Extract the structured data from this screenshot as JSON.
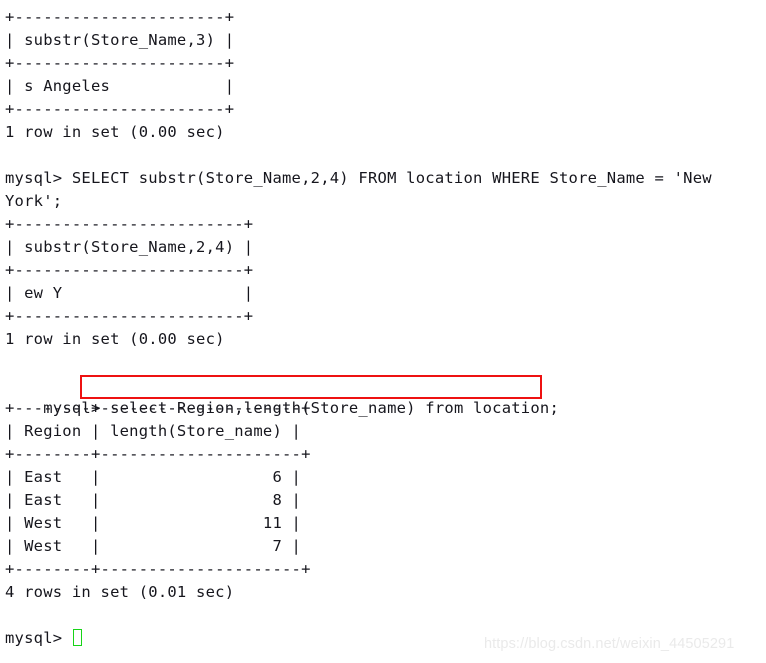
{
  "terminal": {
    "prompt": "mysql> ",
    "cursor_color": "#17d417",
    "text_color": "#16161d",
    "background_color": "#ffffff",
    "annotation_color": "#ee1111",
    "lines": [
      {
        "id": "l01",
        "text": "+----------------------+"
      },
      {
        "id": "l02",
        "text": "| substr(Store_Name,3) |"
      },
      {
        "id": "l03",
        "text": "+----------------------+"
      },
      {
        "id": "l04",
        "text": "| s Angeles            |"
      },
      {
        "id": "l05",
        "text": "+----------------------+"
      },
      {
        "id": "l06",
        "text": "1 row in set (0.00 sec)"
      },
      {
        "id": "l07",
        "text": ""
      },
      {
        "id": "l08",
        "text": "mysql> SELECT substr(Store_Name,2,4) FROM location WHERE Store_Name = 'New"
      },
      {
        "id": "l09",
        "text": "York';"
      },
      {
        "id": "l10",
        "text": "+------------------------+"
      },
      {
        "id": "l11",
        "text": "| substr(Store_Name,2,4) |"
      },
      {
        "id": "l12",
        "text": "+------------------------+"
      },
      {
        "id": "l13",
        "text": "| ew Y                   |"
      },
      {
        "id": "l14",
        "text": "+------------------------+"
      },
      {
        "id": "l15",
        "text": "1 row in set (0.00 sec)"
      },
      {
        "id": "l16",
        "text": ""
      },
      {
        "id": "l17",
        "text": "mysql> select Region,length(Store_name) from location;"
      },
      {
        "id": "l18",
        "text": "+--------+---------------------+"
      },
      {
        "id": "l19",
        "text": "| Region | length(Store_name) |"
      },
      {
        "id": "l20",
        "text": "+--------+---------------------+"
      },
      {
        "id": "l21",
        "text": "| East   |                  6 |"
      },
      {
        "id": "l22",
        "text": "| East   |                  8 |"
      },
      {
        "id": "l23",
        "text": "| West   |                 11 |"
      },
      {
        "id": "l24",
        "text": "| West   |                  7 |"
      },
      {
        "id": "l25",
        "text": "+--------+---------------------+"
      },
      {
        "id": "l26",
        "text": "4 rows in set (0.01 sec)"
      },
      {
        "id": "l27",
        "text": ""
      },
      {
        "id": "l28",
        "text": "mysql> "
      }
    ]
  },
  "queries": [
    {
      "statement": "SELECT substr(Store_Name,2,4) FROM location WHERE Store_Name = 'New York';",
      "result_header": "substr(Store_Name,2,4)",
      "result_values": [
        "ew Y"
      ],
      "status": "1 row in set (0.00 sec)",
      "highlighted": false
    },
    {
      "statement": "select Region,length(Store_name) from location;",
      "status": "4 rows in set (0.01 sec)",
      "highlighted": true
    }
  ],
  "previous_result": {
    "result_header": "substr(Store_Name,3)",
    "result_values": [
      "s Angeles"
    ],
    "status": "1 row in set (0.00 sec)"
  },
  "result_table": {
    "columns": [
      "Region",
      "length(Store_name)"
    ],
    "rows": [
      [
        "East",
        "6"
      ],
      [
        "East",
        "8"
      ],
      [
        "West",
        "11"
      ],
      [
        "West",
        "7"
      ]
    ],
    "row_count_status": "4 rows in set (0.01 sec)"
  },
  "watermark": {
    "text": "https://blog.csdn.net/weixin_44505291"
  }
}
